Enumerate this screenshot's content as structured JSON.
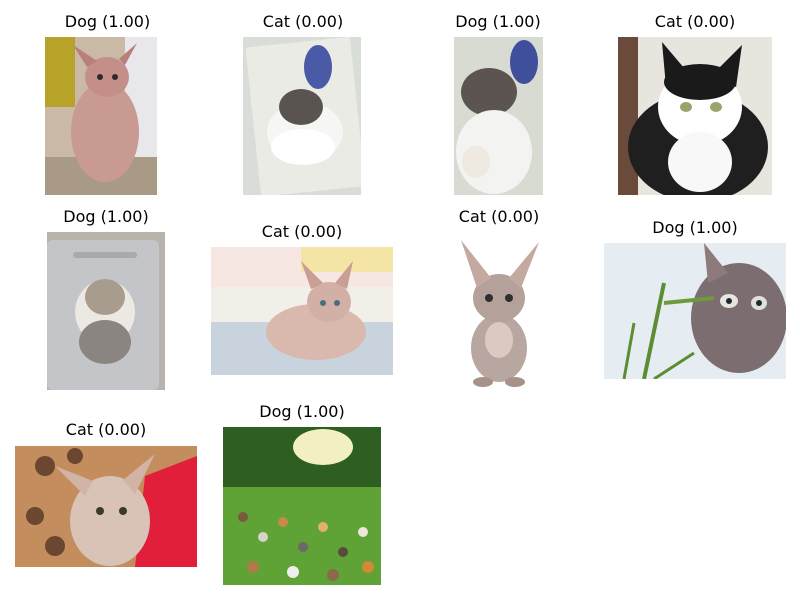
{
  "predictions": [
    {
      "label": "Dog (1.00)",
      "image": "hairless-cat-photo"
    },
    {
      "label": "Cat (0.00)",
      "image": "cat-sticker-card"
    },
    {
      "label": "Dog (1.00)",
      "image": "cat-sticker-closeup"
    },
    {
      "label": "Cat (0.00)",
      "image": "black-white-cat-photo"
    },
    {
      "label": "Dog (1.00)",
      "image": "dog-sticker-on-laptop"
    },
    {
      "label": "Cat (0.00)",
      "image": "sphynx-lying-on-bed"
    },
    {
      "label": "Cat (0.00)",
      "image": "sphynx-sitting-white-bg"
    },
    {
      "label": "Dog (1.00)",
      "image": "sphynx-with-grass"
    },
    {
      "label": "Cat (0.00)",
      "image": "sphynx-on-blanket"
    },
    {
      "label": "Dog (1.00)",
      "image": "cats-crowd-in-park"
    }
  ]
}
